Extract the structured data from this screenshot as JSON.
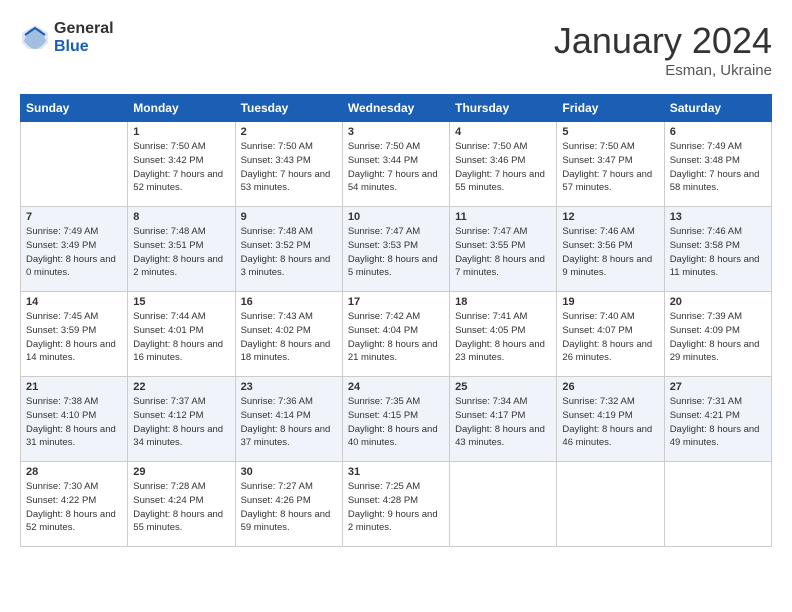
{
  "logo": {
    "general": "General",
    "blue": "Blue"
  },
  "header": {
    "month": "January 2024",
    "location": "Esman, Ukraine"
  },
  "columns": [
    "Sunday",
    "Monday",
    "Tuesday",
    "Wednesday",
    "Thursday",
    "Friday",
    "Saturday"
  ],
  "weeks": [
    [
      {
        "day": "",
        "sunrise": "",
        "sunset": "",
        "daylight": ""
      },
      {
        "day": "1",
        "sunrise": "Sunrise: 7:50 AM",
        "sunset": "Sunset: 3:42 PM",
        "daylight": "Daylight: 7 hours and 52 minutes."
      },
      {
        "day": "2",
        "sunrise": "Sunrise: 7:50 AM",
        "sunset": "Sunset: 3:43 PM",
        "daylight": "Daylight: 7 hours and 53 minutes."
      },
      {
        "day": "3",
        "sunrise": "Sunrise: 7:50 AM",
        "sunset": "Sunset: 3:44 PM",
        "daylight": "Daylight: 7 hours and 54 minutes."
      },
      {
        "day": "4",
        "sunrise": "Sunrise: 7:50 AM",
        "sunset": "Sunset: 3:46 PM",
        "daylight": "Daylight: 7 hours and 55 minutes."
      },
      {
        "day": "5",
        "sunrise": "Sunrise: 7:50 AM",
        "sunset": "Sunset: 3:47 PM",
        "daylight": "Daylight: 7 hours and 57 minutes."
      },
      {
        "day": "6",
        "sunrise": "Sunrise: 7:49 AM",
        "sunset": "Sunset: 3:48 PM",
        "daylight": "Daylight: 7 hours and 58 minutes."
      }
    ],
    [
      {
        "day": "7",
        "sunrise": "Sunrise: 7:49 AM",
        "sunset": "Sunset: 3:49 PM",
        "daylight": "Daylight: 8 hours and 0 minutes."
      },
      {
        "day": "8",
        "sunrise": "Sunrise: 7:48 AM",
        "sunset": "Sunset: 3:51 PM",
        "daylight": "Daylight: 8 hours and 2 minutes."
      },
      {
        "day": "9",
        "sunrise": "Sunrise: 7:48 AM",
        "sunset": "Sunset: 3:52 PM",
        "daylight": "Daylight: 8 hours and 3 minutes."
      },
      {
        "day": "10",
        "sunrise": "Sunrise: 7:47 AM",
        "sunset": "Sunset: 3:53 PM",
        "daylight": "Daylight: 8 hours and 5 minutes."
      },
      {
        "day": "11",
        "sunrise": "Sunrise: 7:47 AM",
        "sunset": "Sunset: 3:55 PM",
        "daylight": "Daylight: 8 hours and 7 minutes."
      },
      {
        "day": "12",
        "sunrise": "Sunrise: 7:46 AM",
        "sunset": "Sunset: 3:56 PM",
        "daylight": "Daylight: 8 hours and 9 minutes."
      },
      {
        "day": "13",
        "sunrise": "Sunrise: 7:46 AM",
        "sunset": "Sunset: 3:58 PM",
        "daylight": "Daylight: 8 hours and 11 minutes."
      }
    ],
    [
      {
        "day": "14",
        "sunrise": "Sunrise: 7:45 AM",
        "sunset": "Sunset: 3:59 PM",
        "daylight": "Daylight: 8 hours and 14 minutes."
      },
      {
        "day": "15",
        "sunrise": "Sunrise: 7:44 AM",
        "sunset": "Sunset: 4:01 PM",
        "daylight": "Daylight: 8 hours and 16 minutes."
      },
      {
        "day": "16",
        "sunrise": "Sunrise: 7:43 AM",
        "sunset": "Sunset: 4:02 PM",
        "daylight": "Daylight: 8 hours and 18 minutes."
      },
      {
        "day": "17",
        "sunrise": "Sunrise: 7:42 AM",
        "sunset": "Sunset: 4:04 PM",
        "daylight": "Daylight: 8 hours and 21 minutes."
      },
      {
        "day": "18",
        "sunrise": "Sunrise: 7:41 AM",
        "sunset": "Sunset: 4:05 PM",
        "daylight": "Daylight: 8 hours and 23 minutes."
      },
      {
        "day": "19",
        "sunrise": "Sunrise: 7:40 AM",
        "sunset": "Sunset: 4:07 PM",
        "daylight": "Daylight: 8 hours and 26 minutes."
      },
      {
        "day": "20",
        "sunrise": "Sunrise: 7:39 AM",
        "sunset": "Sunset: 4:09 PM",
        "daylight": "Daylight: 8 hours and 29 minutes."
      }
    ],
    [
      {
        "day": "21",
        "sunrise": "Sunrise: 7:38 AM",
        "sunset": "Sunset: 4:10 PM",
        "daylight": "Daylight: 8 hours and 31 minutes."
      },
      {
        "day": "22",
        "sunrise": "Sunrise: 7:37 AM",
        "sunset": "Sunset: 4:12 PM",
        "daylight": "Daylight: 8 hours and 34 minutes."
      },
      {
        "day": "23",
        "sunrise": "Sunrise: 7:36 AM",
        "sunset": "Sunset: 4:14 PM",
        "daylight": "Daylight: 8 hours and 37 minutes."
      },
      {
        "day": "24",
        "sunrise": "Sunrise: 7:35 AM",
        "sunset": "Sunset: 4:15 PM",
        "daylight": "Daylight: 8 hours and 40 minutes."
      },
      {
        "day": "25",
        "sunrise": "Sunrise: 7:34 AM",
        "sunset": "Sunset: 4:17 PM",
        "daylight": "Daylight: 8 hours and 43 minutes."
      },
      {
        "day": "26",
        "sunrise": "Sunrise: 7:32 AM",
        "sunset": "Sunset: 4:19 PM",
        "daylight": "Daylight: 8 hours and 46 minutes."
      },
      {
        "day": "27",
        "sunrise": "Sunrise: 7:31 AM",
        "sunset": "Sunset: 4:21 PM",
        "daylight": "Daylight: 8 hours and 49 minutes."
      }
    ],
    [
      {
        "day": "28",
        "sunrise": "Sunrise: 7:30 AM",
        "sunset": "Sunset: 4:22 PM",
        "daylight": "Daylight: 8 hours and 52 minutes."
      },
      {
        "day": "29",
        "sunrise": "Sunrise: 7:28 AM",
        "sunset": "Sunset: 4:24 PM",
        "daylight": "Daylight: 8 hours and 55 minutes."
      },
      {
        "day": "30",
        "sunrise": "Sunrise: 7:27 AM",
        "sunset": "Sunset: 4:26 PM",
        "daylight": "Daylight: 8 hours and 59 minutes."
      },
      {
        "day": "31",
        "sunrise": "Sunrise: 7:25 AM",
        "sunset": "Sunset: 4:28 PM",
        "daylight": "Daylight: 9 hours and 2 minutes."
      },
      {
        "day": "",
        "sunrise": "",
        "sunset": "",
        "daylight": ""
      },
      {
        "day": "",
        "sunrise": "",
        "sunset": "",
        "daylight": ""
      },
      {
        "day": "",
        "sunrise": "",
        "sunset": "",
        "daylight": ""
      }
    ]
  ]
}
